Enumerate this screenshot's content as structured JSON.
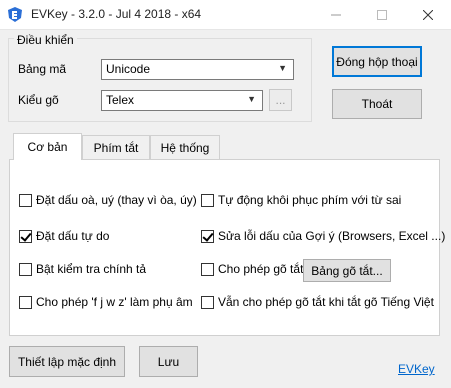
{
  "window": {
    "title": "EVKey - 3.2.0 - Jul  4 2018 - x64",
    "app_icon": "evkey-logo-icon",
    "controls": [
      "minimize-icon",
      "maximize-icon",
      "close-icon"
    ]
  },
  "controls_group": {
    "legend": "Điều khiển",
    "charset_label": "Bảng mã",
    "charset_value": "Unicode",
    "input_method_label": "Kiểu gõ",
    "input_method_value": "Telex",
    "more_button": "..."
  },
  "actions": {
    "close_dialog": "Đóng hộp thoại",
    "exit": "Thoát"
  },
  "tabs": [
    {
      "label": "Cơ bản",
      "active": true
    },
    {
      "label": "Phím tắt",
      "active": false
    },
    {
      "label": "Hệ thống",
      "active": false
    }
  ],
  "options": {
    "old_tone_marks": {
      "label": "Đặt dấu oà, uý (thay vì òa, úy)",
      "checked": false
    },
    "auto_restore": {
      "label": "Tự động khôi phục phím với từ sai",
      "checked": false
    },
    "free_tone": {
      "label": "Đặt dấu tự do",
      "checked": true
    },
    "fix_suggest": {
      "label": "Sửa lỗi dấu của Gợi ý (Browsers, Excel ...)",
      "checked": true
    },
    "spell_check": {
      "label": "Bật kiểm tra chính tả",
      "checked": false
    },
    "allow_shortcut": {
      "label": "Cho phép gõ tắt",
      "checked": false
    },
    "shortcut_table_button": "Bảng gõ tắt...",
    "allow_fjwz": {
      "label": "Cho phép 'f j w z' làm phụ âm",
      "checked": false
    },
    "shortcut_when_off": {
      "label": "Vẫn cho phép gõ tắt khi tắt gõ Tiếng Việt",
      "checked": false
    }
  },
  "footer": {
    "defaults_button": "Thiết lập mặc định",
    "save_button": "Lưu",
    "link": "EVKey"
  },
  "colors": {
    "accent": "#0078d7",
    "link": "#0066cc",
    "window_bg": "#f0f0f0"
  }
}
